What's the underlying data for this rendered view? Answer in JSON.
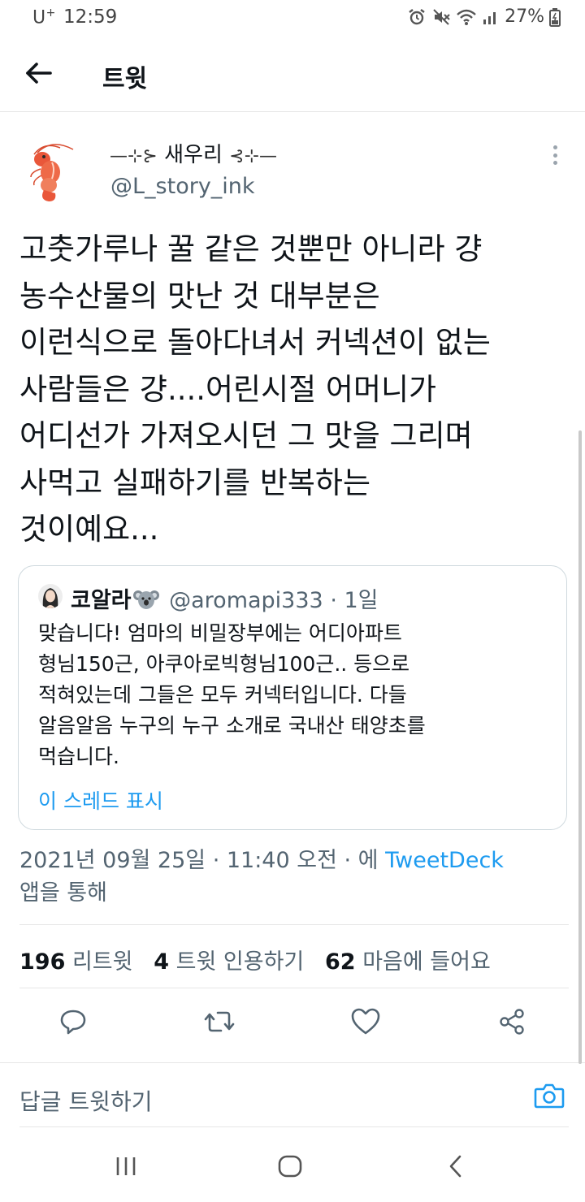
{
  "status_bar": {
    "carrier": "U",
    "carrier_suffix": "+",
    "time": "12:59",
    "battery": "27%",
    "icons": [
      "alarm-icon",
      "mute-icon",
      "wifi-icon",
      "signal-icon",
      "battery-icon"
    ]
  },
  "header": {
    "title": "트윗",
    "back_icon": "arrow-left-icon"
  },
  "tweet": {
    "author": {
      "display_name_prefix": "—⊹⊱",
      "display_name": "새우리",
      "display_name_suffix": "⊰⊹—",
      "handle": "@L_story_ink",
      "avatar_icon": "shrimp-avatar"
    },
    "text_lines": [
      "고춧가루나 꿀 같은 것뿐만 아니라 걍",
      "농수산물의 맛난 것 대부분은",
      "이런식으로 돌아다녀서 커넥션이 없는",
      "사람들은 걍....어린시절 어머니가",
      "어디선가 가져오시던 그 맛을 그리며",
      "사먹고 실패하기를 반복하는",
      "것이예요..."
    ],
    "quoted_tweet": {
      "name": "코알라",
      "name_emoji": "koala-icon",
      "handle": "@aromapi333",
      "separator": "·",
      "age": "1일",
      "text_lines": [
        "맞습니다! 엄마의 비밀장부에는 어디아파트",
        "형님150근, 아쿠아로빅형님100근.. 등으로",
        "적혀있는데 그들은 모두 커넥터입니다. 다들",
        "알음알음 누구의 누구 소개로 국내산 태양초를",
        "먹습니다."
      ],
      "show_thread": "이 스레드 표시"
    },
    "timestamp": "2021년 09월 25일 · 11:40 오전 · 에",
    "via_client": "TweetDeck",
    "via_suffix": "앱을 통해",
    "stats": {
      "retweets_count": "196",
      "retweets_label": "리트윗",
      "quotes_count": "4",
      "quotes_label": "트윗 인용하기",
      "likes_count": "62",
      "likes_label": "마음에 들어요"
    },
    "actions": [
      "reply-icon",
      "retweet-icon",
      "like-icon",
      "share-icon"
    ]
  },
  "reply_bar": {
    "placeholder": "답글 트윗하기",
    "camera_icon": "camera-icon"
  },
  "nav_bar": {
    "buttons": [
      "recent-apps-icon",
      "home-icon",
      "back-icon"
    ]
  },
  "colors": {
    "accent": "#1d9bf0",
    "text": "#0f1419",
    "secondary": "#536471",
    "border": "#cfd9de"
  }
}
